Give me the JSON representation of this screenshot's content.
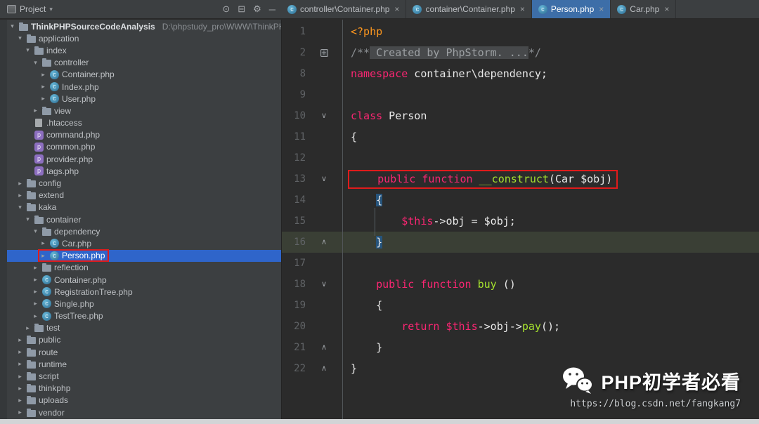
{
  "colors": {
    "panel_bg": "#3c3f41",
    "editor_bg": "#2b2b2b",
    "tree_selection": "#2f65ca",
    "active_tab_bg": "#3d6ea8",
    "keyword": "#f92672",
    "function_name": "#a6e22e",
    "text": "#e8e8e8",
    "php_tag": "#fd971f",
    "annotation_red": "#e01b1b",
    "current_line_bg": "#3a3f35",
    "brace_highlight_bg": "#26547c"
  },
  "header": {
    "project_label": "Project",
    "icons": [
      {
        "name": "locate-file-icon",
        "glyph": "⊙"
      },
      {
        "name": "collapse-all-icon",
        "glyph": "⊟"
      },
      {
        "name": "settings-gear-icon",
        "glyph": "⚙"
      },
      {
        "name": "hide-panel-icon",
        "glyph": "─"
      }
    ]
  },
  "tabs": [
    {
      "label": "controller\\Container.php",
      "active": false
    },
    {
      "label": "container\\Container.php",
      "active": false
    },
    {
      "label": "Person.php",
      "active": true
    },
    {
      "label": "Car.php",
      "active": false
    }
  ],
  "project_tree": {
    "rows": [
      {
        "label": "ThinkPHPSourceCodeAnalysis",
        "path": "D:\\phpstudy_pro\\WWW\\ThinkPHPSourceCo",
        "level": 0,
        "arrow": "down",
        "icon": "folder",
        "bold": true
      },
      {
        "label": "application",
        "level": 1,
        "arrow": "down",
        "icon": "folder"
      },
      {
        "label": "index",
        "level": 2,
        "arrow": "down",
        "icon": "folder"
      },
      {
        "label": "controller",
        "level": 3,
        "arrow": "down",
        "icon": "folder"
      },
      {
        "label": "Container.php",
        "level": 4,
        "arrow": "right",
        "icon": "class"
      },
      {
        "label": "Index.php",
        "level": 4,
        "arrow": "right",
        "icon": "class"
      },
      {
        "label": "User.php",
        "level": 4,
        "arrow": "right",
        "icon": "class"
      },
      {
        "label": "view",
        "level": 3,
        "arrow": "right",
        "icon": "folder"
      },
      {
        "label": ".htaccess",
        "level": 2,
        "arrow": null,
        "icon": "file"
      },
      {
        "label": "command.php",
        "level": 2,
        "arrow": null,
        "icon": "php"
      },
      {
        "label": "common.php",
        "level": 2,
        "arrow": null,
        "icon": "php"
      },
      {
        "label": "provider.php",
        "level": 2,
        "arrow": null,
        "icon": "php"
      },
      {
        "label": "tags.php",
        "level": 2,
        "arrow": null,
        "icon": "php"
      },
      {
        "label": "config",
        "level": 1,
        "arrow": "right",
        "icon": "folder"
      },
      {
        "label": "extend",
        "level": 1,
        "arrow": "right",
        "icon": "folder"
      },
      {
        "label": "kaka",
        "level": 1,
        "arrow": "down",
        "icon": "folder"
      },
      {
        "label": "container",
        "level": 2,
        "arrow": "down",
        "icon": "folder"
      },
      {
        "label": "dependency",
        "level": 3,
        "arrow": "down",
        "icon": "folder"
      },
      {
        "label": "Car.php",
        "level": 4,
        "arrow": "right",
        "icon": "class"
      },
      {
        "label": "Person.php",
        "level": 4,
        "arrow": "right",
        "icon": "class",
        "selected": true,
        "boxed": true
      },
      {
        "label": "reflection",
        "level": 3,
        "arrow": "right",
        "icon": "folder"
      },
      {
        "label": "Container.php",
        "level": 3,
        "arrow": "right",
        "icon": "class"
      },
      {
        "label": "RegistrationTree.php",
        "level": 3,
        "arrow": "right",
        "icon": "class"
      },
      {
        "label": "Single.php",
        "level": 3,
        "arrow": "right",
        "icon": "class"
      },
      {
        "label": "TestTree.php",
        "level": 3,
        "arrow": "right",
        "icon": "class"
      },
      {
        "label": "test",
        "level": 2,
        "arrow": "right",
        "icon": "folder"
      },
      {
        "label": "public",
        "level": 1,
        "arrow": "right",
        "icon": "folder"
      },
      {
        "label": "route",
        "level": 1,
        "arrow": "right",
        "icon": "folder"
      },
      {
        "label": "runtime",
        "level": 1,
        "arrow": "right",
        "icon": "folder"
      },
      {
        "label": "script",
        "level": 1,
        "arrow": "right",
        "icon": "folder"
      },
      {
        "label": "thinkphp",
        "level": 1,
        "arrow": "right",
        "icon": "folder"
      },
      {
        "label": "uploads",
        "level": 1,
        "arrow": "right",
        "icon": "folder"
      },
      {
        "label": "vendor",
        "level": 1,
        "arrow": "right",
        "icon": "folder"
      }
    ]
  },
  "editor": {
    "lines": [
      {
        "n": 1,
        "tokens": [
          [
            "tag",
            "<?php"
          ]
        ]
      },
      {
        "n": 2,
        "fold": "plus",
        "tokens": [
          [
            "cmt",
            "/**"
          ],
          [
            "fold",
            " Created by PhpStorm. ..."
          ],
          [
            "cmt",
            "*/"
          ]
        ]
      },
      {
        "n": 8,
        "tokens": [
          [
            "kw",
            "namespace"
          ],
          [
            "txt",
            " container\\dependency;"
          ]
        ]
      },
      {
        "n": 9,
        "tokens": []
      },
      {
        "n": 10,
        "fold": "down",
        "tokens": [
          [
            "kw",
            "class"
          ],
          [
            "txt",
            " Person"
          ]
        ]
      },
      {
        "n": 11,
        "tokens": [
          [
            "txt",
            "{"
          ]
        ]
      },
      {
        "n": 12,
        "tokens": []
      },
      {
        "n": 13,
        "fold": "down",
        "box": true,
        "tokens": [
          [
            "txt",
            "    "
          ],
          [
            "kw",
            "public function"
          ],
          [
            "fn",
            " __construct"
          ],
          [
            "txt",
            "(Car $obj)"
          ]
        ]
      },
      {
        "n": 14,
        "tokens": [
          [
            "txt",
            "    "
          ],
          [
            "brc",
            "{"
          ]
        ]
      },
      {
        "n": 15,
        "tokens": [
          [
            "txt",
            "        "
          ],
          [
            "kw",
            "$this"
          ],
          [
            "txt",
            "->obj = $obj;"
          ]
        ]
      },
      {
        "n": 16,
        "fold": "up",
        "current": true,
        "tokens": [
          [
            "txt",
            "    "
          ],
          [
            "brc",
            "}"
          ]
        ]
      },
      {
        "n": 17,
        "tokens": []
      },
      {
        "n": 18,
        "fold": "down",
        "tokens": [
          [
            "txt",
            "    "
          ],
          [
            "kw",
            "public function"
          ],
          [
            "fn",
            " buy"
          ],
          [
            "txt",
            " ()"
          ]
        ]
      },
      {
        "n": 19,
        "tokens": [
          [
            "txt",
            "    {"
          ]
        ]
      },
      {
        "n": 20,
        "tokens": [
          [
            "txt",
            "        "
          ],
          [
            "kw",
            "return"
          ],
          [
            "txt",
            " "
          ],
          [
            "kw",
            "$this"
          ],
          [
            "txt",
            "->obj->"
          ],
          [
            "fn",
            "pay"
          ],
          [
            "txt",
            "();"
          ]
        ]
      },
      {
        "n": 21,
        "fold": "up",
        "tokens": [
          [
            "txt",
            "    }"
          ]
        ]
      },
      {
        "n": 22,
        "fold": "up",
        "tokens": [
          [
            "txt",
            "}"
          ]
        ]
      }
    ]
  },
  "watermark": {
    "title": "PHP初学者必看",
    "url": "https://blog.csdn.net/fangkang7"
  }
}
